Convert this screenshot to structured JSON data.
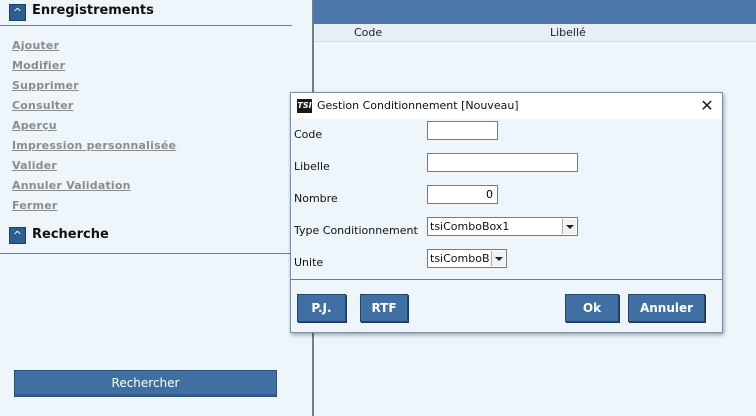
{
  "sidebar": {
    "enregistrements_title": "Enregistrements",
    "recherche_title": "Recherche",
    "toggle_glyph": "^",
    "actions": [
      {
        "label": "Ajouter"
      },
      {
        "label": "Modifier"
      },
      {
        "label": "Supprimer"
      },
      {
        "label": "Consulter"
      },
      {
        "label": "Aperçu"
      },
      {
        "label": "Impression personnalisée"
      },
      {
        "label": "Valider"
      },
      {
        "label": "Annuler Validation"
      },
      {
        "label": "Fermer"
      }
    ],
    "search_button": "Rechercher"
  },
  "grid": {
    "columns": [
      "Code",
      "Libellé"
    ]
  },
  "dialog": {
    "title": "Gestion Conditionnement [Nouveau]",
    "logo_text": "TSI",
    "close_glyph": "✕",
    "fields": {
      "code_label": "Code",
      "code_value": "",
      "libelle_label": "Libelle",
      "libelle_value": "",
      "nombre_label": "Nombre",
      "nombre_value": "0",
      "type_label": "Type Conditionnement",
      "type_value": "tsiComboBox1",
      "unite_label": "Unite",
      "unite_value": "tsiComboBox"
    },
    "buttons": {
      "pj": "P.J.",
      "rtf": "RTF",
      "ok": "Ok",
      "annuler": "Annuler"
    }
  },
  "colors": {
    "accent": "#3f6fa3",
    "background": "#eef5fb",
    "link": "#8c8c8c"
  }
}
